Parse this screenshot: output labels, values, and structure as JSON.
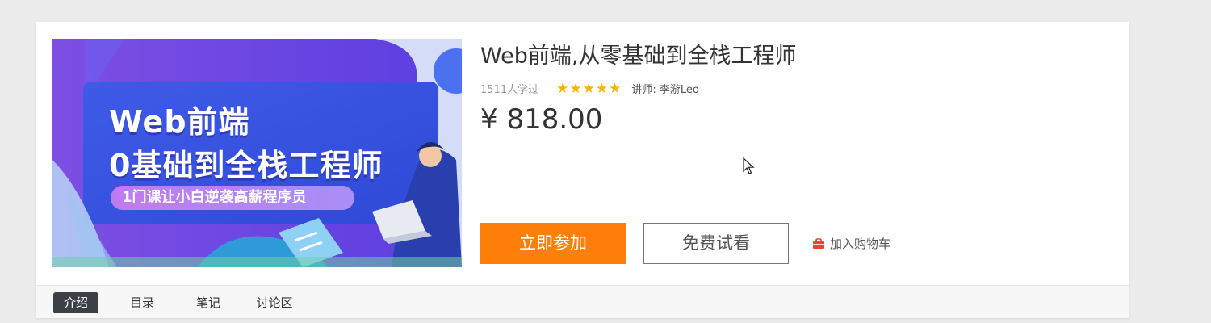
{
  "banner": {
    "title_line1": "Web前端",
    "title_line2": "0基础到全栈工程师",
    "subtitle": "1门课让小白逆袭高薪程序员"
  },
  "course": {
    "title": "Web前端,从零基础到全栈工程师",
    "learners": "1511人学过",
    "rating": 5,
    "teacher": "讲师:  李游Leo",
    "price": "¥ 818.00"
  },
  "actions": {
    "join_label": "立即参加",
    "free_label": "免费试看",
    "cart_label": "加入购物车",
    "cart_icon": "shopping-bag-icon"
  },
  "tabs": [
    {
      "label": "介绍",
      "active": true
    },
    {
      "label": "目录",
      "active": false
    },
    {
      "label": "笔记",
      "active": false
    },
    {
      "label": "讨论区",
      "active": false
    }
  ],
  "colors": {
    "accent_orange": "#ff7f0b",
    "star_gold": "#f7b500",
    "active_tab": "#3c3f46",
    "cart_red": "#e8452c"
  }
}
